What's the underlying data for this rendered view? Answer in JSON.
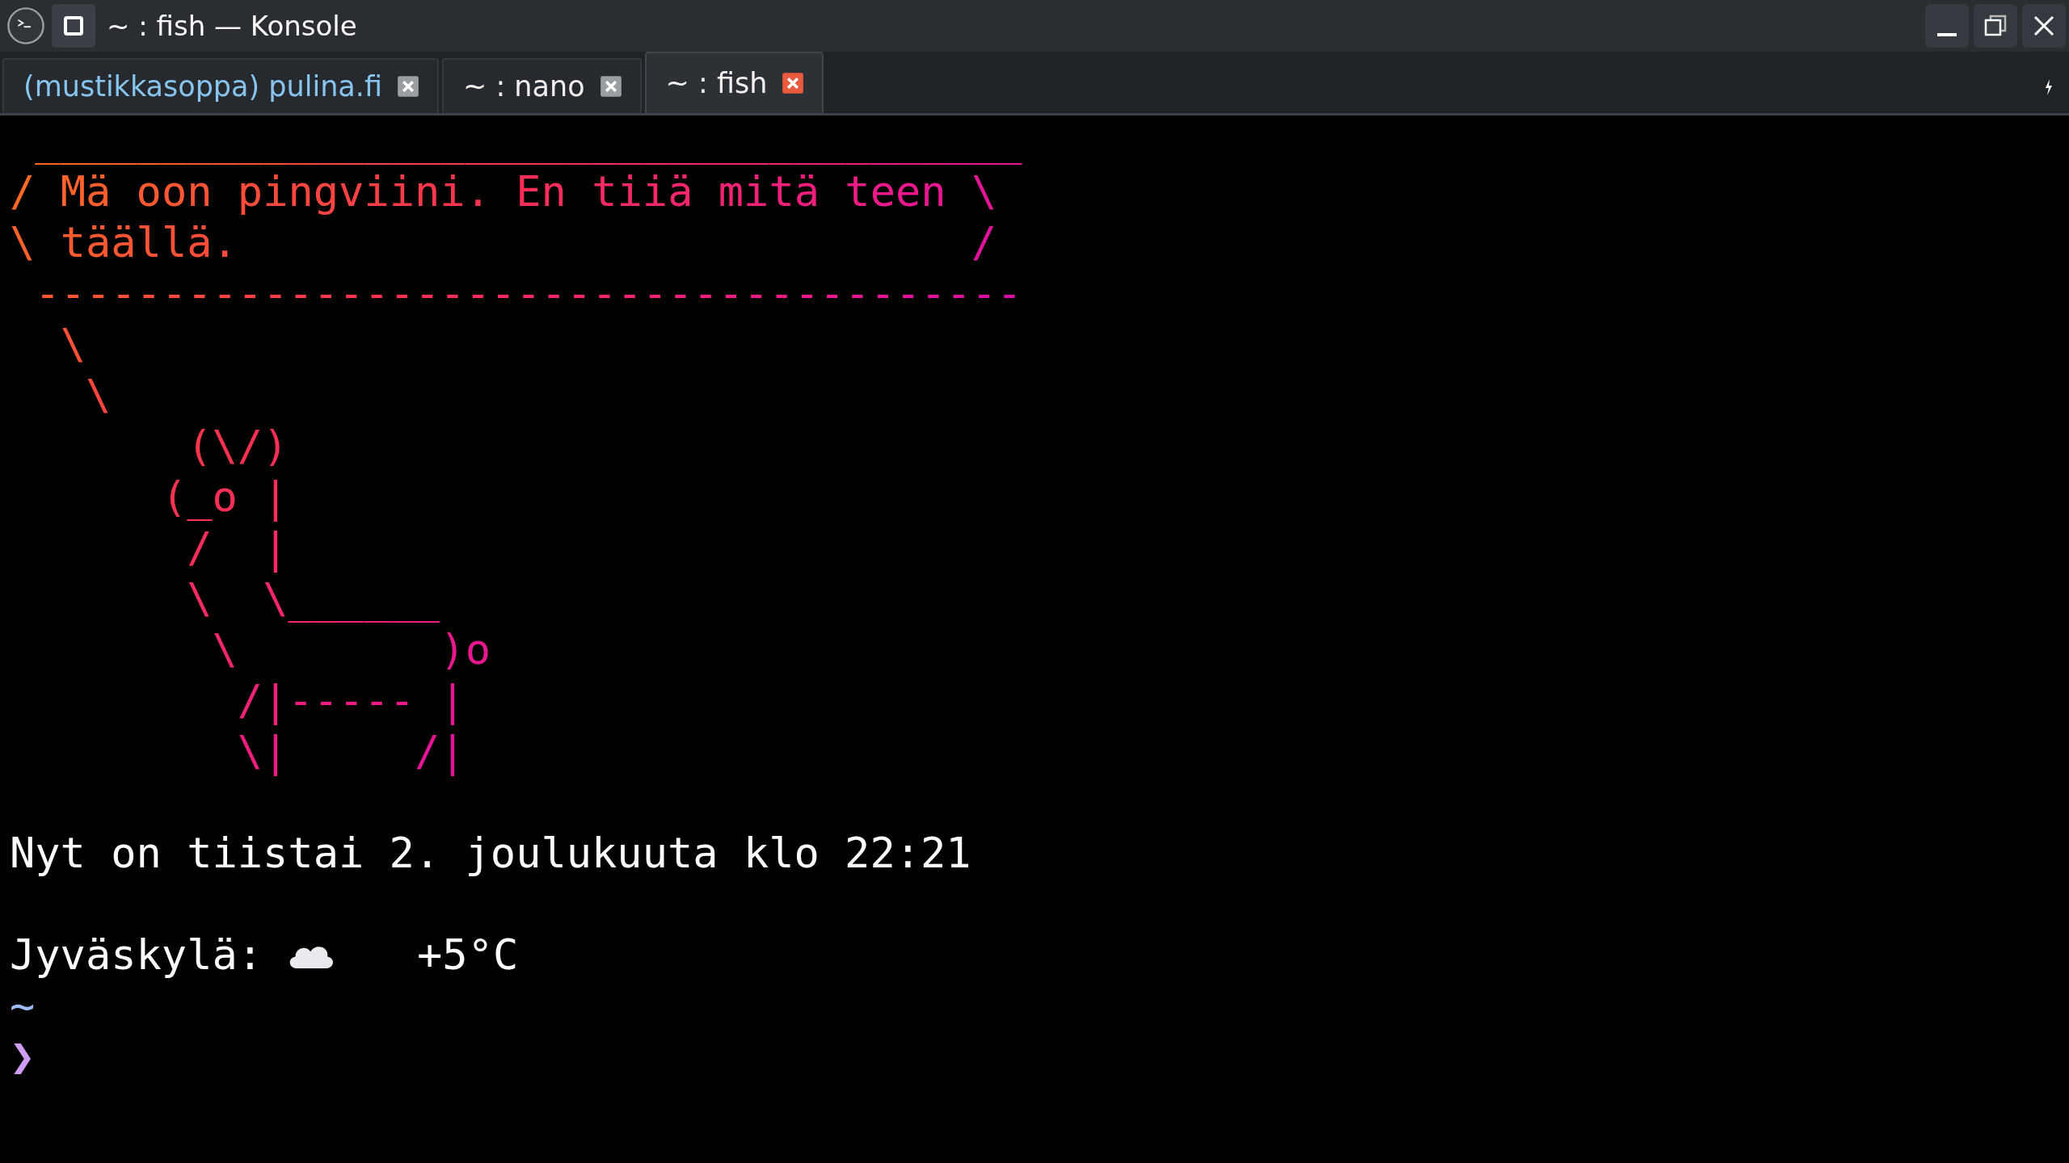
{
  "window": {
    "title": "~ : fish — Konsole"
  },
  "tabs": [
    {
      "label": "(mustikkasoppa) pulina.fi",
      "selected": false,
      "activity": true
    },
    {
      "label": "~ : nano",
      "selected": false,
      "activity": false
    },
    {
      "label": "~ : fish",
      "selected": true,
      "activity": false
    }
  ],
  "terminal": {
    "lines": [
      {
        "kind": "art",
        "text": " _______________________________________"
      },
      {
        "kind": "art",
        "text": "/ Mä oon pingviini. En tiiä mitä teen \\"
      },
      {
        "kind": "art",
        "text": "\\ täällä.",
        "closing": "/"
      },
      {
        "kind": "art",
        "text": " ---------------------------------------"
      },
      {
        "kind": "art",
        "text": "  \\"
      },
      {
        "kind": "art",
        "text": "   \\"
      },
      {
        "kind": "art",
        "text": "       (\\/)"
      },
      {
        "kind": "art",
        "text": "      (_o |"
      },
      {
        "kind": "art",
        "text": "       /  |"
      },
      {
        "kind": "art",
        "text": "       \\  \\______"
      },
      {
        "kind": "art",
        "text": "        \\        )o"
      },
      {
        "kind": "art",
        "text": "         /|----- |"
      },
      {
        "kind": "art",
        "text": "         \\|     /|"
      },
      {
        "kind": "blank"
      },
      {
        "kind": "text",
        "text": "Nyt on tiistai 2. joulukuuta klo 22:21"
      },
      {
        "kind": "blank"
      },
      {
        "kind": "weather",
        "place": "Jyväskylä:",
        "temperature": "+5°C"
      },
      {
        "kind": "cwd",
        "text": "~"
      },
      {
        "kind": "prompt",
        "text": "❯"
      }
    ]
  }
}
